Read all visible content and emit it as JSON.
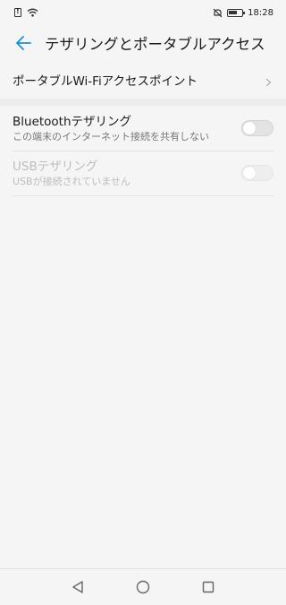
{
  "status_bar": {
    "time": "18:28",
    "icons": [
      "sim-alert-icon",
      "wifi-icon",
      "mute-icon",
      "battery-icon"
    ]
  },
  "header": {
    "title": "テザリングとポータブルアクセス",
    "back_icon": "back-arrow-icon",
    "accent_color": "#1a8fd6"
  },
  "hotspot": {
    "label": "ポータブルWi-Fiアクセスポイント",
    "icon": "chevron-right-icon"
  },
  "bluetooth": {
    "title": "Bluetoothテザリング",
    "subtitle": "この端末のインターネット接続を共有しない",
    "enabled": false
  },
  "usb": {
    "title": "USBテザリング",
    "subtitle": "USBが接続されていません",
    "enabled": false,
    "disabled": true
  },
  "nav_bar": {
    "buttons": [
      "back-triangle-icon",
      "home-circle-icon",
      "recents-square-icon"
    ]
  }
}
